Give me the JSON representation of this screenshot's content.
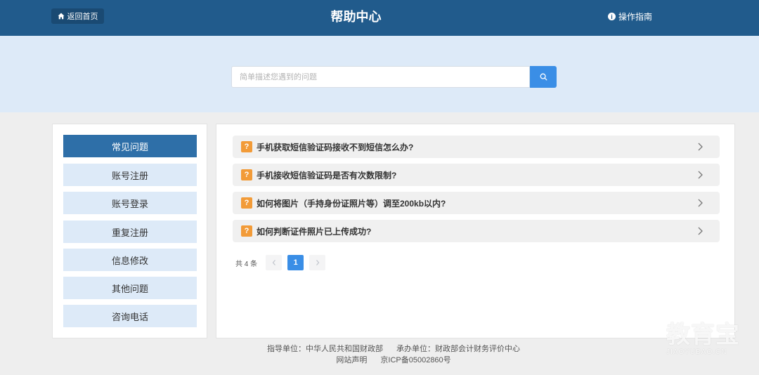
{
  "header": {
    "back_label": "返回首页",
    "title": "帮助中心",
    "guide_label": "操作指南"
  },
  "search": {
    "placeholder": "简单描述您遇到的问题",
    "value": ""
  },
  "sidebar": {
    "items": [
      {
        "label": "常见问题",
        "active": true
      },
      {
        "label": "账号注册",
        "active": false
      },
      {
        "label": "账号登录",
        "active": false
      },
      {
        "label": "重复注册",
        "active": false
      },
      {
        "label": "信息修改",
        "active": false
      },
      {
        "label": "其他问题",
        "active": false
      },
      {
        "label": "咨询电话",
        "active": false
      }
    ]
  },
  "faq": {
    "items": [
      {
        "badge": "?",
        "question": "手机获取短信验证码接收不到短信怎么办?"
      },
      {
        "badge": "?",
        "question": "手机接收短信验证码是否有次数限制?"
      },
      {
        "badge": "?",
        "question": "如何将图片（手持身份证照片等）调至200kb以内?"
      },
      {
        "badge": "?",
        "question": "如何判断证件照片已上传成功?"
      }
    ]
  },
  "pagination": {
    "total_label": "共 4 条",
    "current_page": "1"
  },
  "footer": {
    "guide_unit": "指导单位：中华人民共和国财政部",
    "host_unit": "承办单位：财政部会计财务评价中心",
    "statement": "网站声明",
    "icp": "京ICP备05002860号"
  },
  "watermark": {
    "text": "教育宝",
    "domain": "JIAOYUBAO.CN"
  },
  "colors": {
    "header_bg": "#215b8c",
    "search_band_bg": "#ddeaf8",
    "accent": "#3a8ee6",
    "active_nav": "#2e6fa8",
    "question_badge": "#f29b38"
  }
}
